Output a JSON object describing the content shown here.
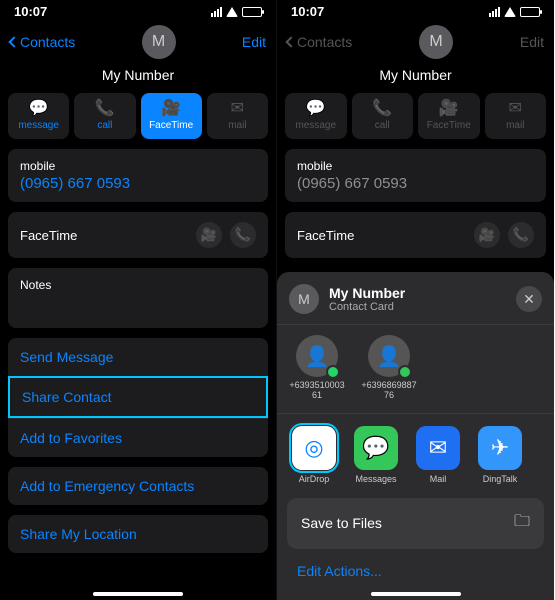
{
  "status": {
    "time": "10:07"
  },
  "left": {
    "nav": {
      "back": "Contacts",
      "edit": "Edit"
    },
    "contact": {
      "initial": "M",
      "name": "My Number"
    },
    "actions": {
      "message": "message",
      "call": "call",
      "facetime": "FaceTime",
      "mail": "mail"
    },
    "phone": {
      "label": "mobile",
      "value": "(0965) 667 0593"
    },
    "facetime": {
      "label": "FaceTime"
    },
    "notes": {
      "label": "Notes"
    },
    "links": {
      "send": "Send Message",
      "share": "Share Contact",
      "fav": "Add to Favorites",
      "emergency": "Add to Emergency Contacts",
      "location": "Share My Location"
    }
  },
  "right": {
    "nav": {
      "back": "Contacts",
      "edit": "Edit"
    },
    "contact": {
      "initial": "M",
      "name": "My Number"
    },
    "actions": {
      "message": "message",
      "call": "call",
      "facetime": "FaceTime",
      "mail": "mail"
    },
    "phone": {
      "label": "mobile",
      "value": "(0965) 667 0593"
    },
    "facetime": {
      "label": "FaceTime"
    },
    "sheet": {
      "head": {
        "initial": "M",
        "title": "My Number",
        "subtitle": "Contact Card"
      },
      "targets": [
        {
          "num": "+6393510003\n61"
        },
        {
          "num": "+6396869887\n76"
        }
      ],
      "apps": {
        "airdrop": "AirDrop",
        "messages": "Messages",
        "mail": "Mail",
        "dingtalk": "DingTalk"
      },
      "save": "Save to Files",
      "edit": "Edit Actions..."
    }
  }
}
